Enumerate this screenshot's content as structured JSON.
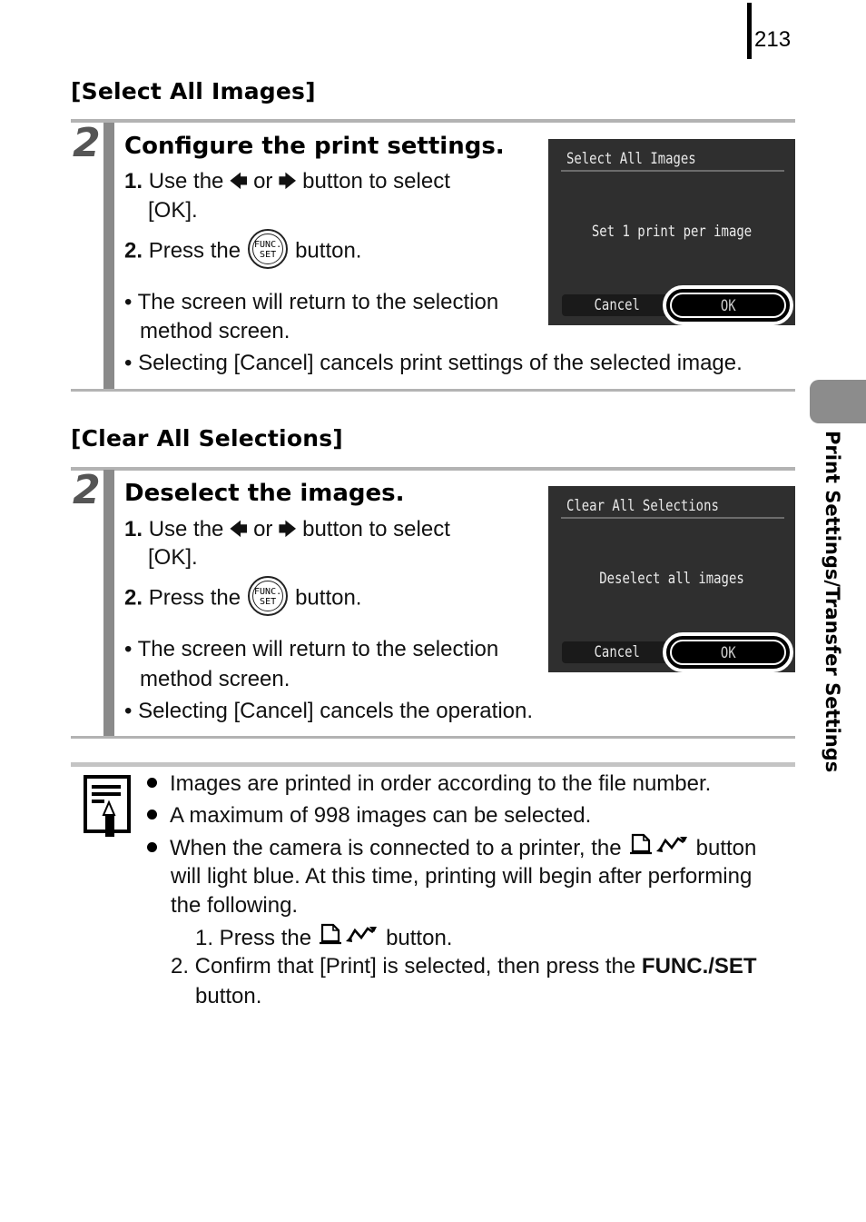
{
  "page": {
    "number": "213",
    "side_tab_label": "Print Settings/Transfer Settings"
  },
  "sections": [
    {
      "heading": "[Select All Images]",
      "step_number": "2",
      "step_title": "Configure the print settings.",
      "instructions": {
        "step1_num": "1.",
        "step1_pre": "Use the",
        "step1_or": "or",
        "step1_post": "button to select",
        "step1_cont": "[OK].",
        "step2_num": "2.",
        "step2_pre": "Press the",
        "step2_post": "button.",
        "left_arrow_icon": "←",
        "right_arrow_icon": "→"
      },
      "func_button": {
        "line1": "FUNC.",
        "line2": "SET"
      },
      "bullets": [
        {
          "line1": "The screen will return to the selection",
          "line2": "method screen."
        },
        {
          "line1": "Selecting [Cancel] cancels print settings of the selected image."
        }
      ],
      "camera_screen": {
        "title": "Select All Images",
        "message": "Set 1 print per image",
        "cancel_label": "Cancel",
        "ok_label": "OK",
        "selected": "OK"
      }
    },
    {
      "heading": "[Clear All Selections]",
      "step_number": "2",
      "step_title": "Deselect the images.",
      "instructions": {
        "step1_num": "1.",
        "step1_pre": "Use the",
        "step1_or": "or",
        "step1_post": "button to select",
        "step1_cont": "[OK].",
        "step2_num": "2.",
        "step2_pre": "Press the",
        "step2_post": "button."
      },
      "func_button": {
        "line1": "FUNC.",
        "line2": "SET"
      },
      "bullets": [
        {
          "line1": "The screen will return to the selection",
          "line2": "method screen."
        },
        {
          "line1": "Selecting [Cancel] cancels the operation."
        }
      ],
      "camera_screen": {
        "title": "Clear All Selections",
        "message": "Deselect all images",
        "cancel_label": "Cancel",
        "ok_label": "OK",
        "selected": "OK"
      }
    }
  ],
  "notes": {
    "icon": "memo-pencil-icon",
    "items": [
      "Images are printed in order according to the file number.",
      "A maximum of 998 images can be selected."
    ],
    "item3": {
      "line1_pre": "When the camera is connected to a printer, the",
      "line1_post": "button",
      "line2": "will light blue. At this time, printing will begin after performing",
      "line3": "the following.",
      "sub1_pre": "1. Press the",
      "sub1_post": "button.",
      "sub2_pre": "2. Confirm that [Print] is selected, then press the",
      "sub2_bold": "FUNC./SET",
      "sub2_cont": "button."
    }
  }
}
